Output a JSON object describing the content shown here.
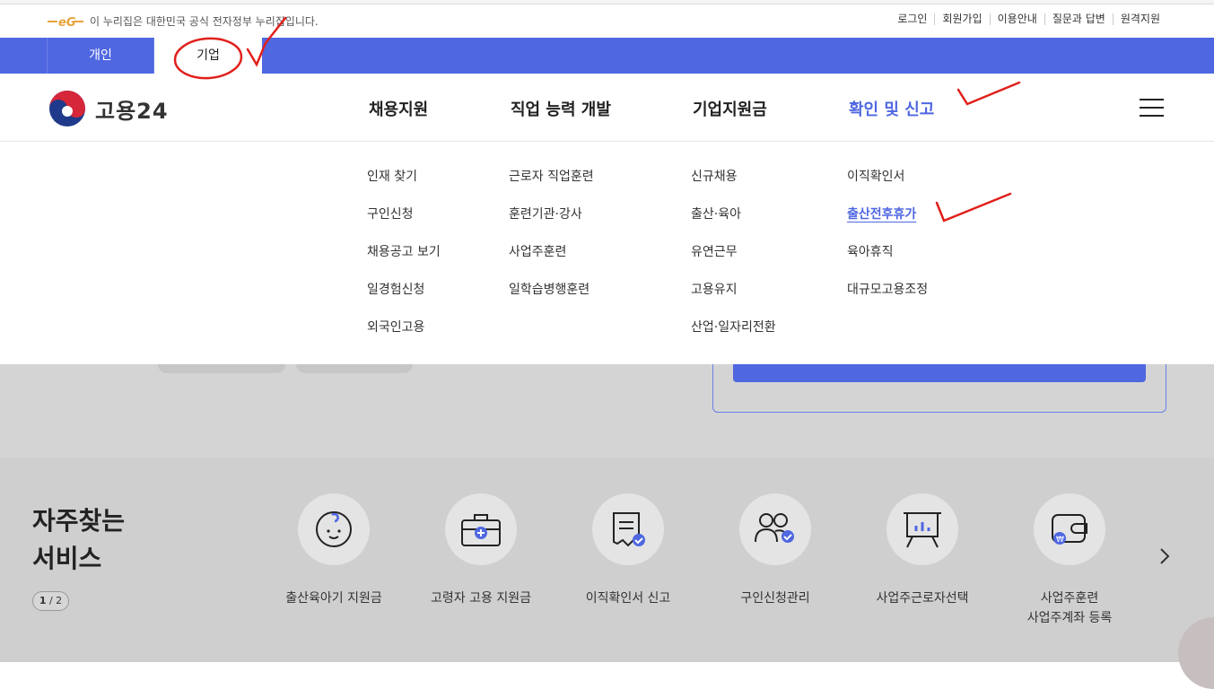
{
  "gov_bar": {
    "notice": "이 누리집은 대한민국 공식 전자정부 누리집입니다.",
    "links": [
      "로그인",
      "회원가입",
      "이용안내",
      "질문과 답변",
      "원격지원"
    ]
  },
  "tabs": {
    "personal": "개인",
    "company": "기업"
  },
  "header": {
    "logo_text": "고용24",
    "nav": [
      "채용지원",
      "직업 능력 개발",
      "기업지원금",
      "확인 및 신고"
    ]
  },
  "mega_menu": {
    "col1": [
      "인재 찾기",
      "구인신청",
      "채용공고 보기",
      "일경험신청",
      "외국인고용"
    ],
    "col2": [
      "근로자 직업훈련",
      "훈련기관·강사",
      "사업주훈련",
      "일학습병행훈련"
    ],
    "col3": [
      "신규채용",
      "출산·육아",
      "유연근무",
      "고용유지",
      "산업·일자리전환"
    ],
    "col4": [
      "이직확인서",
      "출산전후휴가",
      "육아휴직",
      "대규모고용조정"
    ]
  },
  "services": {
    "title_line1": "자주찾는",
    "title_line2": "서비스",
    "pager_current": "1",
    "pager_total": " / 2",
    "items": [
      {
        "label": "출산육아기 지원금",
        "icon": "baby-icon"
      },
      {
        "label": "고령자 고용 지원금",
        "icon": "medical-kit-icon"
      },
      {
        "label": "이직확인서 신고",
        "icon": "certificate-check-icon"
      },
      {
        "label": "구인신청관리",
        "icon": "people-check-icon"
      },
      {
        "label": "사업주근로자선택",
        "icon": "presentation-board-icon"
      },
      {
        "label_line1": "사업주훈련",
        "label_line2": "사업주계좌 등록",
        "icon": "wallet-won-icon"
      }
    ]
  },
  "colors": {
    "primary": "#4f67e0",
    "annotation": "#e0201b"
  }
}
